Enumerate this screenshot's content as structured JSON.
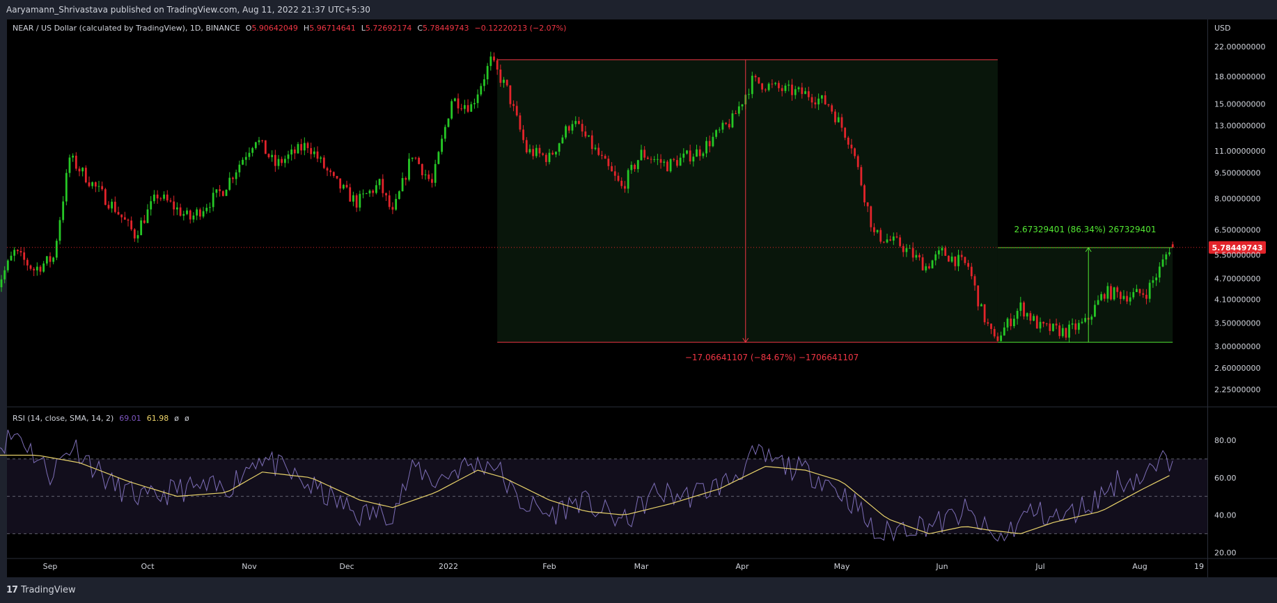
{
  "publisher": "Aaryamann_Shrivastava published on TradingView.com, Aug 11, 2022 21:37 UTC+5:30",
  "footer": {
    "brand": "TradingView"
  },
  "legend": {
    "symbol": "NEAR / US Dollar (calculated by TradingView), 1D, BINANCE",
    "o_label": "O",
    "o": "5.90642049",
    "h_label": "H",
    "h": "5.96714641",
    "l_label": "L",
    "l": "5.72692174",
    "c_label": "C",
    "c": "5.78449743",
    "change": "−0.12220213 (−2.07%)"
  },
  "rsi_legend": {
    "name": "RSI (14, close, SMA, 14, 2)",
    "rsi": "69.01",
    "sma": "61.98",
    "extra1": "ø",
    "extra2": "ø"
  },
  "colors": {
    "up": "#26c826",
    "down": "#e3242b",
    "background": "#000000",
    "rsi_line": "#7e6fb8",
    "rsi_sma": "#e8d26a",
    "rsi_band": "#120e1c",
    "measure_red": "#f23645",
    "measure_green": "#53e833"
  },
  "chart_data": [
    {
      "type": "candlestick",
      "currency": "USD",
      "scale": "log",
      "ylim": [
        2.1,
        24.0
      ],
      "x_tick_labels": [
        "Sep",
        "Oct",
        "Nov",
        "Dec",
        "2022",
        "Feb",
        "Mar",
        "Apr",
        "May",
        "Jun",
        "Jul",
        "Aug",
        "19"
      ],
      "x_tick_dates": [
        "2021-09-01",
        "2021-10-01",
        "2021-11-01",
        "2021-12-01",
        "2022-01-01",
        "2022-02-01",
        "2022-03-01",
        "2022-04-01",
        "2022-05-01",
        "2022-06-01",
        "2022-07-01",
        "2022-08-01",
        "2022-08-19"
      ],
      "y_tick_labels": [
        "22.00000000",
        "18.00000000",
        "15.00000000",
        "13.00000000",
        "11.00000000",
        "9.50000000",
        "8.00000000",
        "6.50000000",
        "5.50000000",
        "4.70000000",
        "4.10000000",
        "3.50000000",
        "3.00000000",
        "2.60000000",
        "2.25000000"
      ],
      "y_ticks": [
        22,
        18,
        15,
        13,
        11,
        9.5,
        8,
        6.5,
        5.5,
        4.7,
        4.1,
        3.5,
        3.0,
        2.6,
        2.25
      ],
      "last_price": 5.78449743,
      "last_price_label": "5.78449743",
      "price_path": [
        [
          "2021-08-15",
          4.2
        ],
        [
          "2021-08-22",
          5.6
        ],
        [
          "2021-08-28",
          5.0
        ],
        [
          "2021-09-03",
          5.4
        ],
        [
          "2021-09-08",
          10.5
        ],
        [
          "2021-09-16",
          8.6
        ],
        [
          "2021-09-22",
          7.5
        ],
        [
          "2021-09-28",
          6.3
        ],
        [
          "2021-10-05",
          8.2
        ],
        [
          "2021-10-15",
          7.0
        ],
        [
          "2021-10-25",
          8.5
        ],
        [
          "2021-11-04",
          12.0
        ],
        [
          "2021-11-10",
          10.0
        ],
        [
          "2021-11-20",
          11.5
        ],
        [
          "2021-11-28",
          9.0
        ],
        [
          "2021-12-05",
          7.8
        ],
        [
          "2021-12-12",
          8.8
        ],
        [
          "2021-12-16",
          7.2
        ],
        [
          "2021-12-22",
          10.8
        ],
        [
          "2021-12-28",
          8.8
        ],
        [
          "2022-01-03",
          15.5
        ],
        [
          "2022-01-09",
          14.8
        ],
        [
          "2022-01-15",
          20.0
        ],
        [
          "2022-01-20",
          16.5
        ],
        [
          "2022-01-26",
          11.0
        ],
        [
          "2022-02-02",
          10.5
        ],
        [
          "2022-02-09",
          13.5
        ],
        [
          "2022-02-16",
          11.0
        ],
        [
          "2022-02-24",
          8.6
        ],
        [
          "2022-03-02",
          10.8
        ],
        [
          "2022-03-10",
          10.0
        ],
        [
          "2022-03-20",
          11.0
        ],
        [
          "2022-03-30",
          13.5
        ],
        [
          "2022-04-05",
          17.5
        ],
        [
          "2022-04-14",
          16.5
        ],
        [
          "2022-04-22",
          16.0
        ],
        [
          "2022-04-28",
          15.0
        ],
        [
          "2022-05-05",
          11.5
        ],
        [
          "2022-05-10",
          7.5
        ],
        [
          "2022-05-12",
          6.3
        ],
        [
          "2022-05-20",
          5.9
        ],
        [
          "2022-05-28",
          5.1
        ],
        [
          "2022-06-02",
          5.6
        ],
        [
          "2022-06-10",
          5.1
        ],
        [
          "2022-06-14",
          3.8
        ],
        [
          "2022-06-18",
          3.1
        ],
        [
          "2022-06-26",
          3.9
        ],
        [
          "2022-07-02",
          3.4
        ],
        [
          "2022-07-10",
          3.3
        ],
        [
          "2022-07-16",
          3.5
        ],
        [
          "2022-07-22",
          4.3
        ],
        [
          "2022-07-30",
          4.2
        ],
        [
          "2022-08-04",
          4.3
        ],
        [
          "2022-08-08",
          5.0
        ],
        [
          "2022-08-11",
          5.78
        ]
      ],
      "annotations": [
        {
          "type": "price_range",
          "color": "red",
          "start": "2022-01-16",
          "end": "2022-06-18",
          "from_price": 20.15,
          "to_price": 3.08,
          "label": "−17.06641107 (−84.67%) −1706641107"
        },
        {
          "type": "price_range",
          "color": "green",
          "start": "2022-06-18",
          "end": "2022-08-11",
          "from_price": 3.08,
          "to_price": 5.78,
          "label": "2.67329401 (86.34%) 267329401"
        }
      ]
    },
    {
      "type": "line",
      "title": "RSI (14, close, SMA, 14, 2)",
      "ylim": [
        16,
        96
      ],
      "y_tick_labels": [
        "80.00",
        "60.00",
        "40.00",
        "20.00"
      ],
      "y_ticks": [
        80,
        60,
        40,
        20
      ],
      "bands": [
        30,
        50,
        70
      ],
      "series": [
        {
          "values_path": [
            [
              "2021-08-15",
              76
            ],
            [
              "2021-08-22",
              84
            ],
            [
              "2021-09-01",
              62
            ],
            [
              "2021-09-08",
              78
            ],
            [
              "2021-09-20",
              56
            ],
            [
              "2021-10-01",
              48
            ],
            [
              "2021-10-10",
              54
            ],
            [
              "2021-10-25",
              54
            ],
            [
              "2021-11-04",
              72
            ],
            [
              "2021-11-15",
              60
            ],
            [
              "2021-11-25",
              50
            ],
            [
              "2021-12-05",
              40
            ],
            [
              "2021-12-15",
              42
            ],
            [
              "2021-12-22",
              66
            ],
            [
              "2021-12-28",
              58
            ],
            [
              "2022-01-05",
              66
            ],
            [
              "2022-01-15",
              68
            ],
            [
              "2022-01-22",
              48
            ],
            [
              "2022-02-01",
              40
            ],
            [
              "2022-02-10",
              48
            ],
            [
              "2022-02-24",
              36
            ],
            [
              "2022-03-05",
              52
            ],
            [
              "2022-03-15",
              50
            ],
            [
              "2022-03-28",
              58
            ],
            [
              "2022-04-05",
              72
            ],
            [
              "2022-04-15",
              66
            ],
            [
              "2022-04-25",
              60
            ],
            [
              "2022-05-05",
              46
            ],
            [
              "2022-05-12",
              28
            ],
            [
              "2022-05-20",
              34
            ],
            [
              "2022-06-01",
              36
            ],
            [
              "2022-06-08",
              42
            ],
            [
              "2022-06-18",
              26
            ],
            [
              "2022-06-28",
              42
            ],
            [
              "2022-07-08",
              38
            ],
            [
              "2022-07-18",
              48
            ],
            [
              "2022-07-25",
              58
            ],
            [
              "2022-08-02",
              60
            ],
            [
              "2022-08-08",
              68
            ],
            [
              "2022-08-11",
              69.01
            ]
          ]
        },
        {
          "values_path": [
            [
              "2021-08-15",
              72
            ],
            [
              "2021-08-28",
              72
            ],
            [
              "2021-09-10",
              68
            ],
            [
              "2021-09-25",
              58
            ],
            [
              "2021-10-10",
              50
            ],
            [
              "2021-10-25",
              52
            ],
            [
              "2021-11-05",
              63
            ],
            [
              "2021-11-20",
              60
            ],
            [
              "2021-12-05",
              48
            ],
            [
              "2021-12-15",
              44
            ],
            [
              "2021-12-28",
              52
            ],
            [
              "2022-01-10",
              64
            ],
            [
              "2022-01-18",
              60
            ],
            [
              "2022-02-01",
              48
            ],
            [
              "2022-02-12",
              42
            ],
            [
              "2022-02-24",
              40
            ],
            [
              "2022-03-10",
              46
            ],
            [
              "2022-03-25",
              54
            ],
            [
              "2022-04-08",
              66
            ],
            [
              "2022-04-20",
              64
            ],
            [
              "2022-05-01",
              58
            ],
            [
              "2022-05-15",
              38
            ],
            [
              "2022-05-28",
              30
            ],
            [
              "2022-06-08",
              34
            ],
            [
              "2022-06-15",
              32
            ],
            [
              "2022-06-25",
              30
            ],
            [
              "2022-07-05",
              36
            ],
            [
              "2022-07-20",
              42
            ],
            [
              "2022-08-02",
              54
            ],
            [
              "2022-08-11",
              61.98
            ]
          ]
        }
      ]
    }
  ]
}
